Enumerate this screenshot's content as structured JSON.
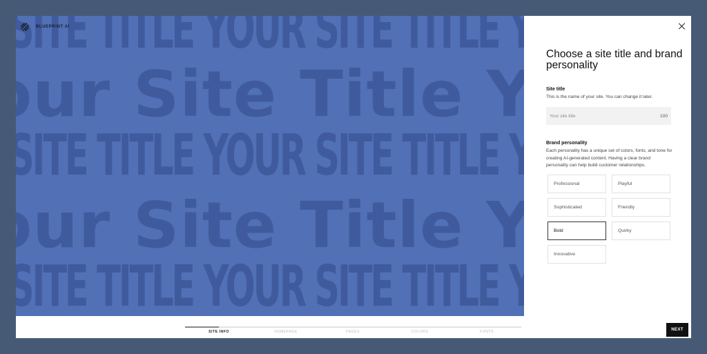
{
  "brand": {
    "name": "BLUEPRINT AI",
    "logo_icon": "blueprint-logo-icon"
  },
  "hero": {
    "rows": [
      "SITE TITLE YOUR SITE TITLE YOUR SITE",
      "our Site Title Your Site Title Y",
      "SITE TITLE YOUR SITE TITLE YOUR SITE",
      "our Site Title Your Site Title Y",
      "SITE TITLE YOUR SITE TITLE YOUR SITE"
    ],
    "bg_color": "#5170b5",
    "text_color": "#3f5b9e"
  },
  "panel": {
    "close_icon": "close-icon",
    "title": "Choose a site title and brand personality",
    "site_title": {
      "label": "Site title",
      "description": "This is the name of your site. You can change it later.",
      "placeholder": "Your site title",
      "value": "",
      "counter": "100"
    },
    "brand_personality": {
      "label": "Brand personality",
      "description": "Each personality has a unique set of colors, fonts, and tone for creating AI-generated content. Having a clear brand personality can help build customer relationships.",
      "options": [
        "Professional",
        "Playful",
        "Sophisticated",
        "Friendly",
        "Bold",
        "Quirky",
        "Innovative"
      ],
      "selected": "Bold"
    }
  },
  "footer": {
    "steps": [
      "SITE INFO",
      "HOMEPAGE",
      "PAGES",
      "COLORS",
      "FONTS"
    ],
    "active_step": "SITE INFO",
    "progress": 0.1,
    "next_label": "NEXT"
  }
}
